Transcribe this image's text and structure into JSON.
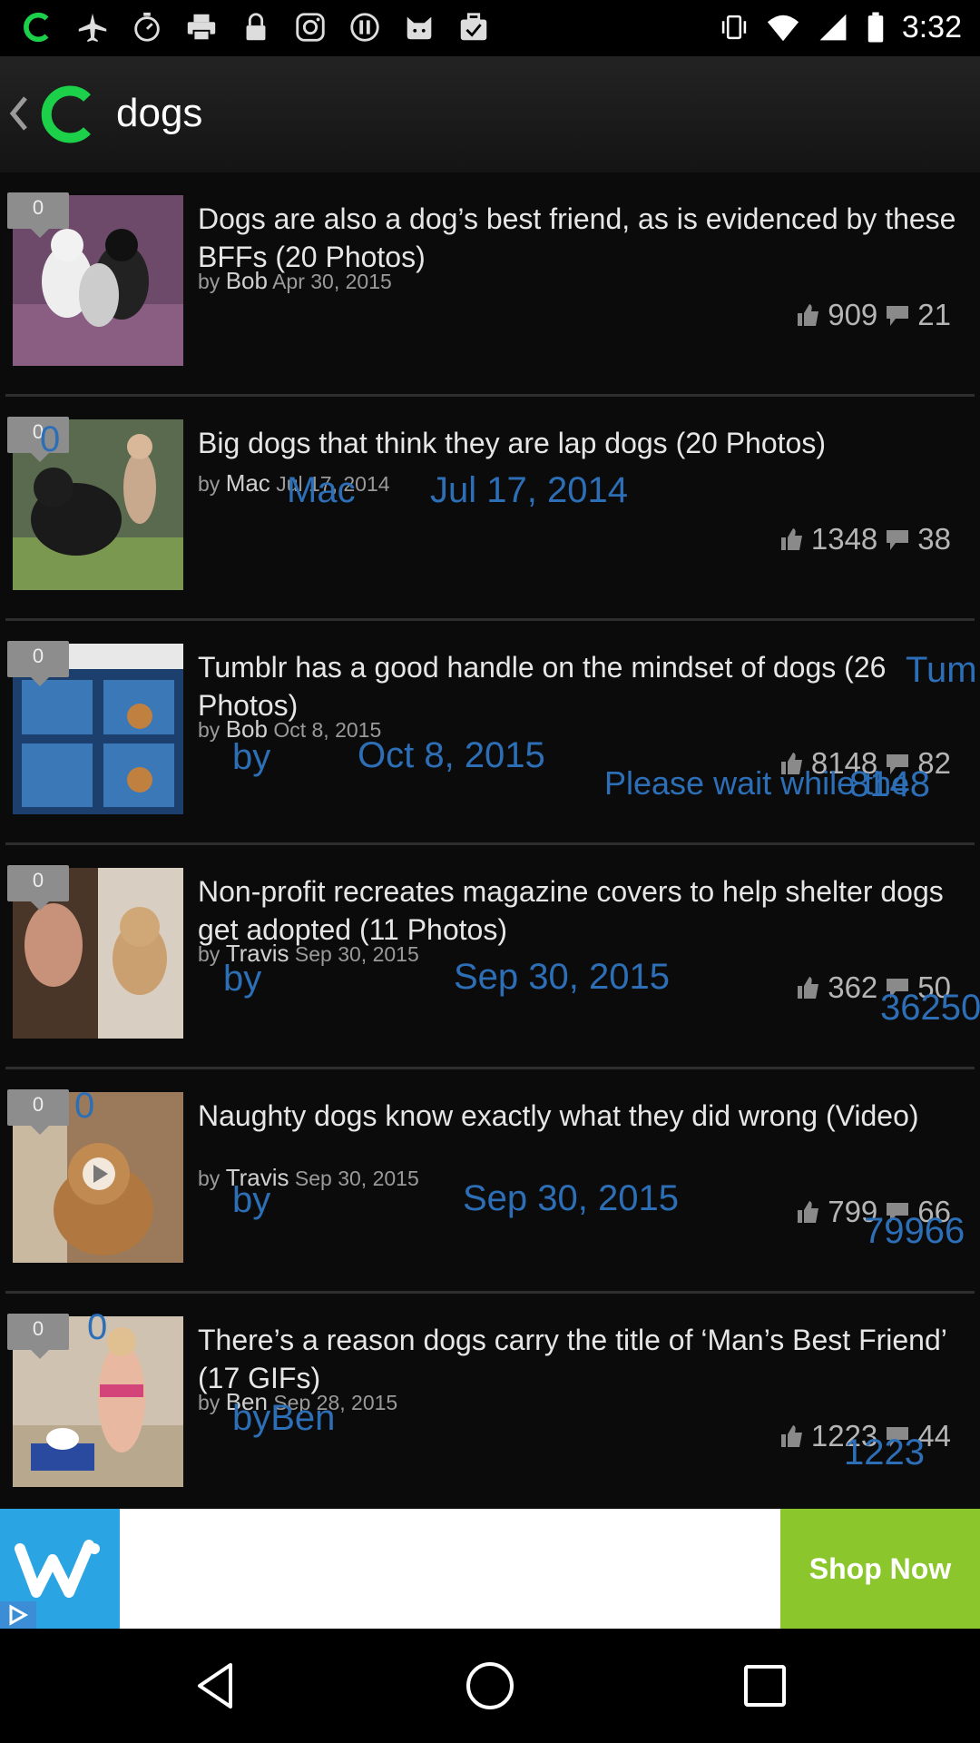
{
  "status_bar": {
    "time": "3:32",
    "icons": [
      "app-c-icon",
      "airplane-icon",
      "stopwatch-icon",
      "printer-icon",
      "lock-icon",
      "instagram-icon",
      "coin-icon",
      "cat-icon",
      "briefcase-check-icon",
      "vibrate-icon",
      "wifi-icon",
      "signal-icon",
      "battery-icon"
    ]
  },
  "app_bar": {
    "title": "dogs"
  },
  "colors": {
    "accent": "#1dd04a",
    "overlay_text": "#2d6fb7",
    "ad_button": "#8bc72c"
  },
  "items": [
    {
      "badge": "0",
      "title": "Dogs are also a dog’s best friend, as is evidenced by these BFFs (20 Photos)",
      "by": "by",
      "author": "Bob",
      "date": "Apr 30, 2015",
      "likes": "909",
      "comments": "21"
    },
    {
      "badge": "0",
      "title": "Big dogs that think they are lap dogs (20 Photos)",
      "by": "by",
      "author": "Mac",
      "date": "Jul 17, 2014",
      "likes": "1348",
      "comments": "38"
    },
    {
      "badge": "0",
      "title": "Tumblr has a good handle on the mindset of dogs (26 Photos)",
      "by": "by",
      "author": "Bob",
      "date": "Oct 8, 2015",
      "likes": "8148",
      "comments": "82"
    },
    {
      "badge": "0",
      "title": "Non-profit recreates magazine covers to help shelter dogs get adopted (11 Photos)",
      "by": "by",
      "author": "Travis",
      "date": "Sep 30, 2015",
      "likes": "362",
      "comments": "50"
    },
    {
      "badge": "0",
      "title": "Naughty dogs know exactly what they did wrong (Video)",
      "by": "by",
      "author": "Travis",
      "date": "Sep 30, 2015",
      "likes": "799",
      "comments": "66"
    },
    {
      "badge": "0",
      "title": "There’s a reason dogs carry the title of ‘Man’s Best Friend’ (17 GIFs)",
      "by": "by",
      "author": "Ben",
      "date": "Sep 28, 2015",
      "likes": "1223",
      "comments": "44"
    }
  ],
  "overlays": {
    "o1": "0",
    "o2": "Mac",
    "o3": "Jul 17, 2014",
    "o4": "Tum",
    "o5": "by",
    "o6": "Oct 8, 2015",
    "o7": "Please wait while the",
    "o8": "8148",
    "o9": "by",
    "o10": "Sep 30, 2015",
    "o11": "36250",
    "o12": "0",
    "o13": "by",
    "o14": "Sep 30, 2015",
    "o15": "79966",
    "o16": "0",
    "o17": "byBen",
    "o18": "1223"
  },
  "ad": {
    "brand_icon": "wish-logo-icon",
    "button": "Shop Now"
  },
  "nav": [
    "back-icon",
    "home-icon",
    "recents-icon"
  ]
}
